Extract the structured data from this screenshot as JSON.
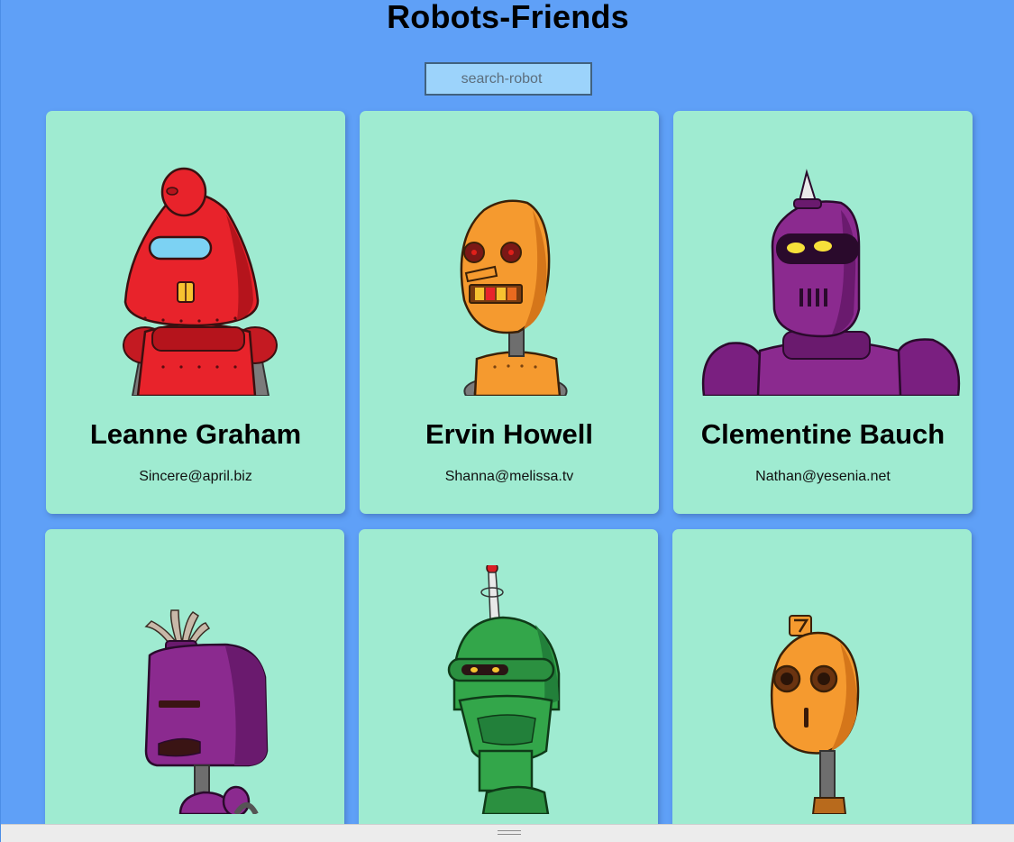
{
  "app": {
    "title": "Robots-Friends"
  },
  "search": {
    "placeholder": "search-robot",
    "value": ""
  },
  "robots": [
    {
      "name": "Leanne Graham",
      "email": "Sincere@april.biz",
      "color": "#e8232b",
      "icon": "red-robot-icon"
    },
    {
      "name": "Ervin Howell",
      "email": "Shanna@melissa.tv",
      "color": "#f59a2f",
      "icon": "orange-robot-icon"
    },
    {
      "name": "Clementine Bauch",
      "email": "Nathan@yesenia.net",
      "color": "#8b2a8f",
      "icon": "purple-robot-icon"
    },
    {
      "name": "",
      "email": "",
      "color": "#8b2a8f",
      "icon": "purple-robot-icon"
    },
    {
      "name": "",
      "email": "",
      "color": "#33a64a",
      "icon": "green-robot-icon"
    },
    {
      "name": "",
      "email": "",
      "color": "#f59a2f",
      "icon": "orange-robot-icon"
    }
  ],
  "colors": {
    "background": "#5fa0f7",
    "card": "#9febd1",
    "search_bg": "#9cd3fb"
  }
}
